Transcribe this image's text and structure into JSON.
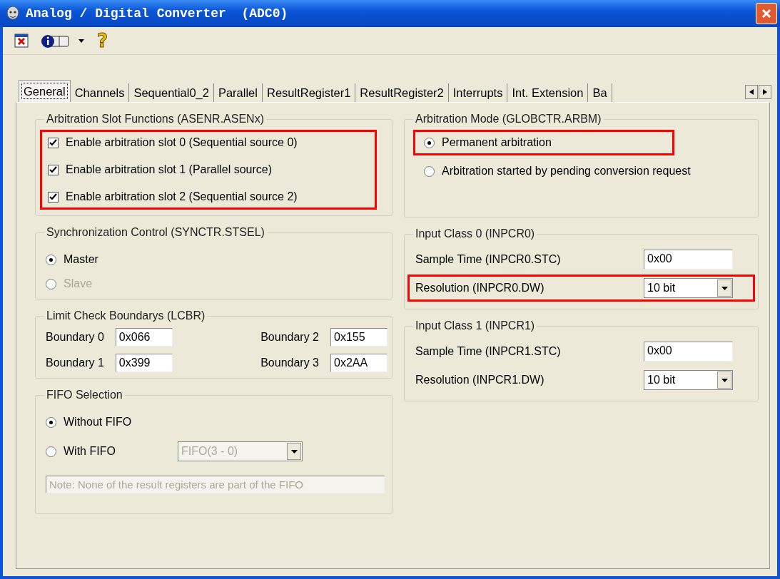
{
  "window": {
    "title": "Analog / Digital Converter  (ADC0)"
  },
  "toolbar": {
    "help_glyph": "?"
  },
  "tabs": [
    {
      "label": "General",
      "selected": true
    },
    {
      "label": "Channels",
      "selected": false
    },
    {
      "label": "Sequential0_2",
      "selected": false
    },
    {
      "label": "Parallel",
      "selected": false
    },
    {
      "label": "ResultRegister1",
      "selected": false
    },
    {
      "label": "ResultRegister2",
      "selected": false
    },
    {
      "label": "Interrupts",
      "selected": false
    },
    {
      "label": "Int. Extension",
      "selected": false
    },
    {
      "label": "Ba",
      "selected": false
    }
  ],
  "arbitration_slots": {
    "title": "Arbitration Slot Functions (ASENR.ASENx)",
    "highlighted": true,
    "items": [
      {
        "label": "Enable arbitration slot 0 (Sequential source 0)",
        "checked": true
      },
      {
        "label": "Enable arbitration slot 1 (Parallel source)",
        "checked": true
      },
      {
        "label": "Enable arbitration slot 2 (Sequential source 2)",
        "checked": true
      }
    ]
  },
  "synchronization": {
    "title": "Synchronization Control (SYNCTR.STSEL)",
    "options": [
      {
        "label": "Master",
        "selected": true,
        "disabled": false
      },
      {
        "label": "Slave",
        "selected": false,
        "disabled": true
      }
    ]
  },
  "limit_check": {
    "title": "Limit Check Boundarys (LCBR)",
    "boundaries": [
      {
        "label": "Boundary 0",
        "value": "0x066"
      },
      {
        "label": "Boundary 2",
        "value": "0x155"
      },
      {
        "label": "Boundary 1",
        "value": "0x399"
      },
      {
        "label": "Boundary 3",
        "value": "0x2AA"
      }
    ]
  },
  "fifo": {
    "title": "FIFO Selection",
    "options": [
      {
        "label": "Without FIFO",
        "selected": true
      },
      {
        "label": "With FIFO",
        "selected": false
      }
    ],
    "dropdown": {
      "value": "FIFO(3 - 0)",
      "disabled": true
    },
    "note": {
      "value": "Note: None of the result registers are part of the FIFO",
      "disabled": true
    }
  },
  "arbitration_mode": {
    "title": "Arbitration Mode (GLOBCTR.ARBM)",
    "options": [
      {
        "label": "Permanent arbitration",
        "selected": true,
        "highlighted": true
      },
      {
        "label": "Arbitration started by pending conversion request",
        "selected": false,
        "highlighted": false
      }
    ]
  },
  "input_classes": [
    {
      "title": "Input Class 0 (INPCR0)",
      "sample_time": {
        "label": "Sample Time  (INPCR0.STC)",
        "value": "0x00"
      },
      "resolution": {
        "label": "Resolution  (INPCR0.DW)",
        "value": "10 bit",
        "highlighted": true
      }
    },
    {
      "title": "Input Class 1 (INPCR1)",
      "sample_time": {
        "label": "Sample Time  (INPCR1.STC)",
        "value": "0x00"
      },
      "resolution": {
        "label": "Resolution  (INPCR1.DW)",
        "value": "10 bit",
        "highlighted": false
      }
    }
  ]
}
